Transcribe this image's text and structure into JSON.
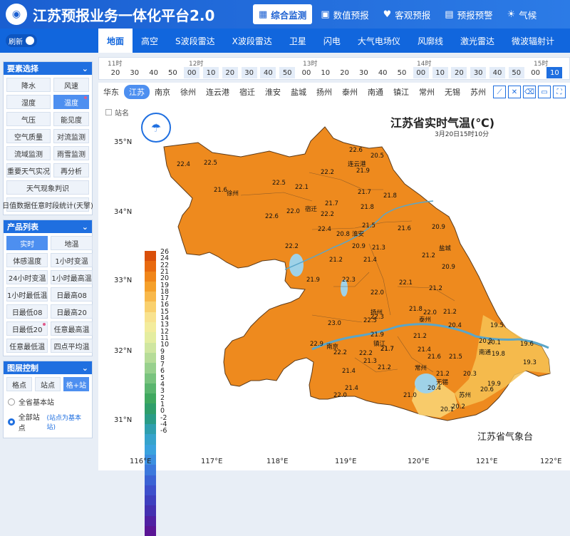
{
  "app": {
    "title": "江苏预报业务一体化平台2.0"
  },
  "nav": [
    {
      "label": "综合监测",
      "icon": "chart-icon",
      "active": true
    },
    {
      "label": "数值预报",
      "icon": "monitor-icon",
      "active": false
    },
    {
      "label": "客观预报",
      "icon": "heart-icon",
      "active": false
    },
    {
      "label": "预报预警",
      "icon": "alert-icon",
      "active": false
    },
    {
      "label": "气候",
      "icon": "sun-icon",
      "active": false
    }
  ],
  "refresh_label": "刷新",
  "categories": [
    {
      "label": "地面",
      "active": true
    },
    {
      "label": "高空"
    },
    {
      "label": "S波段雷达"
    },
    {
      "label": "X波段雷达"
    },
    {
      "label": "卫星"
    },
    {
      "label": "闪电"
    },
    {
      "label": "大气电场仪"
    },
    {
      "label": "风廓线"
    },
    {
      "label": "激光雷达"
    },
    {
      "label": "微波辐射计"
    }
  ],
  "sidebar": {
    "elements": {
      "title": "要素选择",
      "items": [
        {
          "label": "降水"
        },
        {
          "label": "风速"
        },
        {
          "label": "湿度"
        },
        {
          "label": "温度",
          "active": true,
          "dot": true
        },
        {
          "label": "气压"
        },
        {
          "label": "能见度"
        },
        {
          "label": "空气质量"
        },
        {
          "label": "对流监测"
        },
        {
          "label": "流域监测"
        },
        {
          "label": "雨雪监测"
        },
        {
          "label": "重要天气实况"
        },
        {
          "label": "再分析"
        },
        {
          "label": "天气现象判识",
          "full": true
        },
        {
          "label": "日值数据任意时段统计(天擎)",
          "full": true
        }
      ]
    },
    "products": {
      "title": "产品列表",
      "items": [
        {
          "label": "实时",
          "active": true
        },
        {
          "label": "地温"
        },
        {
          "label": "体感温度"
        },
        {
          "label": "1小时变温"
        },
        {
          "label": "24小时变温"
        },
        {
          "label": "1小时最高温"
        },
        {
          "label": "1小时最低温"
        },
        {
          "label": "日最高08"
        },
        {
          "label": "日最低08"
        },
        {
          "label": "日最高20"
        },
        {
          "label": "日最低20",
          "dot": true
        },
        {
          "label": "任意最高温"
        },
        {
          "label": "任意最低温"
        },
        {
          "label": "四点平均温"
        }
      ]
    },
    "layers": {
      "title": "图层控制",
      "items": [
        {
          "label": "格点"
        },
        {
          "label": "站点"
        },
        {
          "label": "格+站",
          "active": true
        }
      ],
      "radios": [
        {
          "label": "全省基本站",
          "on": false
        },
        {
          "label": "全部站点",
          "note": "(站点为基本站)",
          "on": true
        }
      ]
    }
  },
  "timeline": {
    "hours": [
      "11时",
      "12时",
      "13时",
      "14时",
      "15时"
    ],
    "minutes": [
      "20",
      "30",
      "40",
      "50",
      "00",
      "10",
      "20",
      "30",
      "40",
      "50",
      "00",
      "10",
      "20",
      "30",
      "40",
      "50",
      "00",
      "10",
      "20",
      "30",
      "40",
      "50",
      "00",
      "10"
    ],
    "active_index": 23
  },
  "regions": [
    {
      "label": "华东"
    },
    {
      "label": "江苏",
      "active": true
    },
    {
      "label": "南京"
    },
    {
      "label": "徐州"
    },
    {
      "label": "连云港"
    },
    {
      "label": "宿迁"
    },
    {
      "label": "淮安"
    },
    {
      "label": "盐城"
    },
    {
      "label": "扬州"
    },
    {
      "label": "泰州"
    },
    {
      "label": "南通"
    },
    {
      "label": "镇江"
    },
    {
      "label": "常州"
    },
    {
      "label": "无锡"
    },
    {
      "label": "苏州"
    }
  ],
  "tools": [
    "ruler-icon",
    "cross-icon",
    "erase-icon",
    "save-icon",
    "fullscreen-icon"
  ],
  "map": {
    "station_toggle": "站名",
    "title": "江苏省实时气温(℃)",
    "subtitle": "3月20日15时10分",
    "agency": "江苏省气象台",
    "lat_labels": [
      "35°N",
      "34°N",
      "33°N",
      "32°N",
      "31°N"
    ],
    "lon_labels": [
      "116°E",
      "117°E",
      "118°E",
      "119°E",
      "120°E",
      "121°E",
      "122°E"
    ],
    "legend_values": [
      "26",
      "24",
      "22",
      "21",
      "20",
      "19",
      "18",
      "17",
      "16",
      "15",
      "14",
      "13",
      "12",
      "11",
      "10",
      "9",
      "8",
      "7",
      "6",
      "5",
      "4",
      "3",
      "2",
      "1",
      "0",
      "-2",
      "-4",
      "-6"
    ],
    "legend_colors": [
      "#d94f0a",
      "#e8690f",
      "#f08519",
      "#f5a02a",
      "#f8b84a",
      "#f9d06d",
      "#f8e28e",
      "#f3ec9c",
      "#e4eda0",
      "#cfe6a0",
      "#b6dc98",
      "#98d08d",
      "#79c37e",
      "#5ab56e",
      "#3fa85f",
      "#2f9e6a",
      "#2a9c86",
      "#2f9fae",
      "#36a3cc",
      "#3aa2de",
      "#3c8fe0",
      "#3c78dc",
      "#3b62d4",
      "#3d4fcb",
      "#3e3fbe",
      "#4430b0",
      "#5020a2",
      "#5a1595"
    ],
    "values": [
      {
        "v": "22.6"
      },
      {
        "v": "20.5"
      },
      {
        "v": "22.5"
      },
      {
        "v": "22.4"
      },
      {
        "v": "21.9"
      },
      {
        "v": "22.2"
      },
      {
        "v": "22.5"
      },
      {
        "v": "21.6"
      },
      {
        "v": "22.1"
      },
      {
        "v": "21.7"
      },
      {
        "v": "21.8"
      },
      {
        "v": "21.7"
      },
      {
        "v": "21.8"
      },
      {
        "v": "22.0"
      },
      {
        "v": "22.6"
      },
      {
        "v": "22.2"
      },
      {
        "v": "21.5"
      },
      {
        "v": "22.4"
      },
      {
        "v": "20.8"
      },
      {
        "v": "21.6"
      },
      {
        "v": "20.9"
      },
      {
        "v": "22.2"
      },
      {
        "v": "20.9"
      },
      {
        "v": "21.3"
      },
      {
        "v": "21.2"
      },
      {
        "v": "21.4"
      },
      {
        "v": "21.2"
      },
      {
        "v": "20.9"
      },
      {
        "v": "21.9"
      },
      {
        "v": "22.3"
      },
      {
        "v": "22.1"
      },
      {
        "v": "21.2"
      },
      {
        "v": "22.0"
      },
      {
        "v": "21.8"
      },
      {
        "v": "22.0"
      },
      {
        "v": "21.2"
      },
      {
        "v": "23.0"
      },
      {
        "v": "22.5"
      },
      {
        "v": "22.3"
      },
      {
        "v": "20.4"
      },
      {
        "v": "19.5"
      },
      {
        "v": "21.9"
      },
      {
        "v": "21.2"
      },
      {
        "v": "20.2"
      },
      {
        "v": "20.1"
      },
      {
        "v": "22.9"
      },
      {
        "v": "21.7"
      },
      {
        "v": "21.4"
      },
      {
        "v": "19.6"
      },
      {
        "v": "22.2"
      },
      {
        "v": "22.2"
      },
      {
        "v": "21.7"
      },
      {
        "v": "21.6"
      },
      {
        "v": "21.5"
      },
      {
        "v": "19.8"
      },
      {
        "v": "21.3"
      },
      {
        "v": "21.2"
      },
      {
        "v": "19.3"
      },
      {
        "v": "21.4"
      },
      {
        "v": "21.2"
      },
      {
        "v": "20.3"
      },
      {
        "v": "21.4"
      },
      {
        "v": "20.4"
      },
      {
        "v": "19.9"
      },
      {
        "v": "22.0"
      },
      {
        "v": "21.0"
      },
      {
        "v": "20.6"
      },
      {
        "v": "20.1"
      },
      {
        "v": "20.2"
      }
    ],
    "cities": [
      {
        "name": "连云港"
      },
      {
        "name": "徐州"
      },
      {
        "name": "宿迁"
      },
      {
        "name": "淮安"
      },
      {
        "name": "盐城"
      },
      {
        "name": "扬州"
      },
      {
        "name": "泰州"
      },
      {
        "name": "镇江"
      },
      {
        "name": "南京"
      },
      {
        "name": "南通"
      },
      {
        "name": "常州"
      },
      {
        "name": "无锡"
      },
      {
        "name": "苏州"
      }
    ],
    "colors": {
      "province_fill": "#ee8a1e",
      "lake": "#9fd2e8",
      "river": "#5aa6c9"
    }
  }
}
